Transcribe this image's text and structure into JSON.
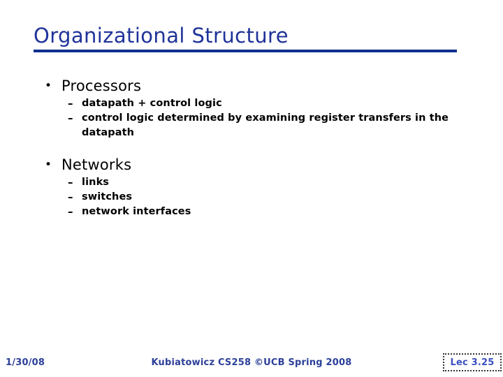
{
  "slide": {
    "title": "Organizational Structure",
    "title_color": "#1f3399",
    "rule_color": "#0f2f8f",
    "body_color": "#000000",
    "footer_color": "#2b3f99",
    "lec_color": "#3a4fbf",
    "bullets": {
      "level1_marker": "•",
      "level2_marker": "–"
    },
    "content": [
      {
        "heading": "Processors",
        "sub": [
          "datapath + control logic",
          "control logic determined by examining register transfers in the datapath"
        ]
      },
      {
        "heading": "Networks",
        "sub": [
          "links",
          "switches",
          "network interfaces"
        ]
      }
    ]
  },
  "footer": {
    "date": "1/30/08",
    "center": "Kubiatowicz CS258 ©UCB Spring 2008",
    "lec": "Lec 3.25"
  }
}
